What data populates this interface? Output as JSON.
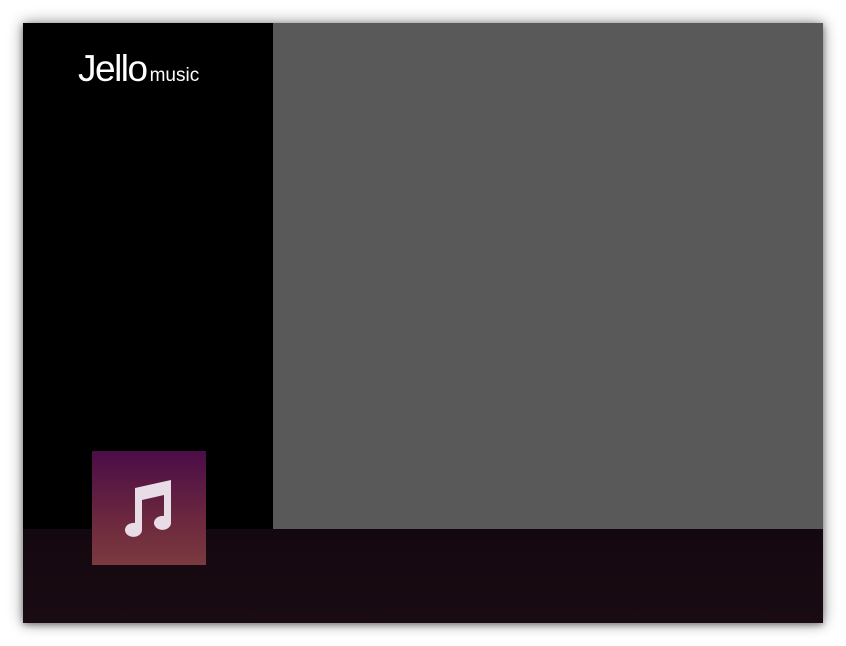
{
  "app": {
    "logo_main": "Jello",
    "logo_sub": "music"
  },
  "player": {
    "album_art_icon": "music-note-icon"
  },
  "colors": {
    "sidebar_bg": "#000000",
    "content_bg": "#595959",
    "player_bar_bg": "#160a10",
    "album_art_top": "#4a0d47",
    "album_art_bottom": "#7a3a3e",
    "icon_color": "#e8dde6"
  }
}
